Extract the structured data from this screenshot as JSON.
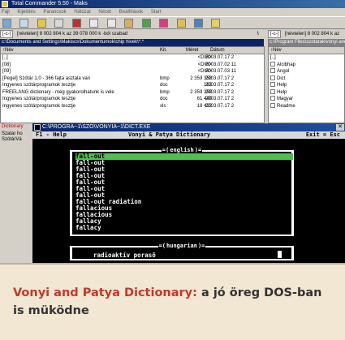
{
  "total_commander": {
    "title": "Total Commander 5.50 - Maks",
    "menu": [
      "Fájl",
      "Kijelölés",
      "Parancsok",
      "Hálózat",
      "Nézet",
      "Beállítások",
      "Start"
    ],
    "left": {
      "drive_label": "[-c-]",
      "drive_info": "[névtelen]  8 002 804 k az 39 078 000 k -ból szabad",
      "path": "c:\\Documents and Settings\\Makiscs\\Dokumentumok\\chip hivek\\*.*",
      "columns": {
        "name": "↑Név",
        "ext": "Kit.",
        "size": "Méret",
        "date": "Dátum"
      },
      "files": [
        {
          "name": "[..]",
          "ext": "",
          "size": "<DIR>",
          "date": "2003.07.17 2"
        },
        {
          "name": "[08]",
          "ext": "",
          "size": "<DIR>",
          "date": "2003.07.02 11"
        },
        {
          "name": "[09]",
          "ext": "",
          "size": "<DIR>",
          "date": "2003.07.03 11"
        },
        {
          "name": "[Pegel] Szótár 1.0 - 366 fajta asztala van",
          "ext": "bmp",
          "size": "2 359 350",
          "date": "2003.07.17 2"
        },
        {
          "name": "Ingyenes szótárprogramok tesztje",
          "ext": "doc",
          "size": "162",
          "date": "2003.07.17 2"
        },
        {
          "name": "FREELANG dictionary - még gyakorolhatunk is vele",
          "ext": "bmp",
          "size": "2 359 350",
          "date": "2003.07.17 2"
        },
        {
          "name": "Ingyenes szótárprogramok tesztje",
          "ext": "doc",
          "size": "61 440",
          "date": "2003.07.17 2"
        },
        {
          "name": "Ingyenes szótárprogramok tesztje",
          "ext": "xls",
          "size": "18 432",
          "date": "2003.07.17 2"
        },
        {
          "name": "Dictionary",
          "ext": "",
          "size": "",
          "date": ""
        },
        {
          "name": "Szatar ho",
          "ext": "",
          "size": "",
          "date": ""
        },
        {
          "name": "SzótárVá",
          "ext": "",
          "size": "",
          "date": ""
        }
      ]
    },
    "right": {
      "separator": "\\",
      "drive_label": "[-c-]",
      "drive_info": "[névtelen]  8 002 804 k az",
      "path": "c:\\Program Files\\szotarak\\vonyi and pat",
      "columns": {
        "name": "↑Név"
      },
      "files": [
        "[..]",
        "Alcibhap",
        "Angol",
        "Dict",
        "Help",
        "Help",
        "Magyar",
        "Readme"
      ]
    }
  },
  "dos_window": {
    "title": "C:\\PROGRA~1\\SZO\\VONYIA~1\\DICT.EXE",
    "close_glyph": "✕",
    "menu": {
      "key": "F1 - Help",
      "title": "Vonyi & Patya Dictionary",
      "exit": "Exit = Esc"
    },
    "english_box": {
      "title": "english",
      "entries": [
        "fall-out",
        "fall-out",
        "fall-out",
        "fall-out",
        "fall-out",
        "fall-out",
        "fall-out",
        "fall-out radiation",
        "fallacious",
        "fallacious",
        "fallacy",
        "fallacy"
      ],
      "selected_index": 0
    },
    "hungarian_box": {
      "title": "hungarian",
      "value": "radioaktív porasõ"
    }
  },
  "caption": {
    "title": "Vonyi and Patya Dictionary:",
    "text": " a jó öreg DOS-ban is müködne"
  },
  "colors": {
    "accent": "#c0392b",
    "dos_highlight": "#4ec04e",
    "titlebar": "#0a246a"
  }
}
